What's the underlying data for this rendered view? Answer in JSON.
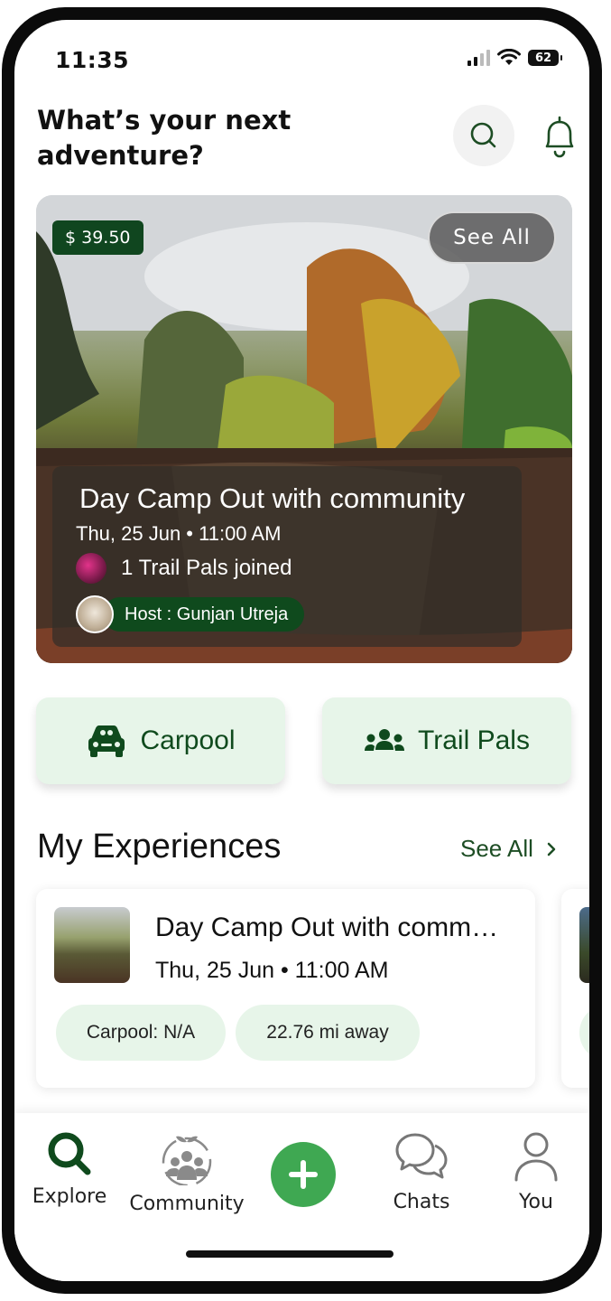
{
  "status_bar": {
    "time": "11:35",
    "battery": "62"
  },
  "header": {
    "title": "What’s your next adventure?"
  },
  "hero": {
    "price": "$ 39.50",
    "see_all": "See All",
    "title": "Day Camp Out with community",
    "date": "Thu, 25 Jun • 11:00 AM",
    "joined": "1 Trail Pals joined",
    "host": "Host : Gunjan Utreja"
  },
  "actions": {
    "carpool": "Carpool",
    "trail_pals": "Trail Pals"
  },
  "experiences": {
    "title": "My Experiences",
    "see_all": "See All",
    "items": [
      {
        "title": "Day Camp Out with comm…",
        "date": "Thu, 25 Jun • 11:00 AM",
        "carpool": "Carpool: N/A",
        "distance": "22.76 mi away"
      }
    ]
  },
  "nav": {
    "explore": "Explore",
    "community": "Community",
    "chats": "Chats",
    "you": "You"
  },
  "colors": {
    "brand_green": "#0f4a1d",
    "accent_green": "#3fa852",
    "chip_bg": "#e7f5e9"
  }
}
